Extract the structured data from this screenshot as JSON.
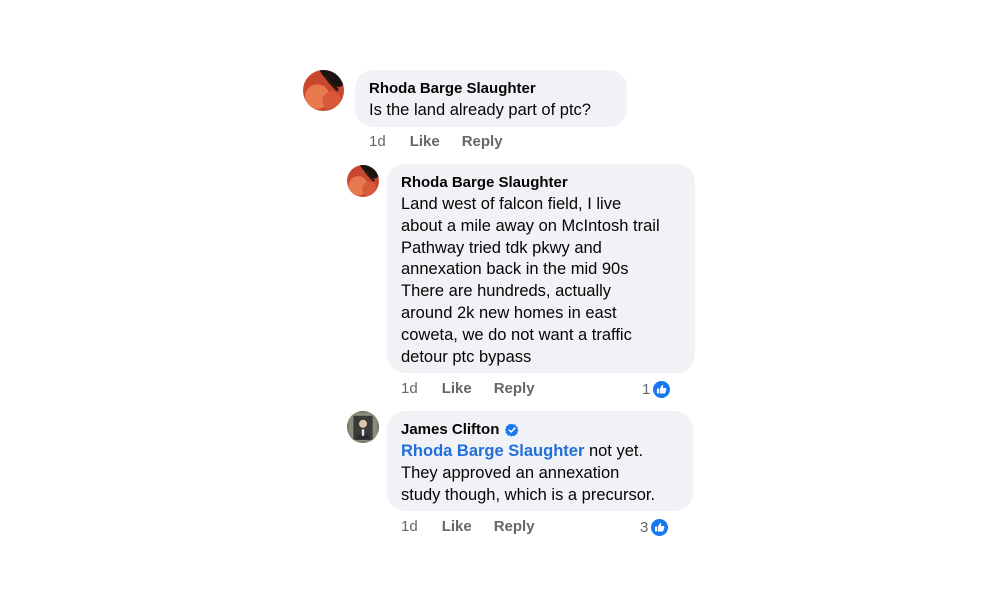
{
  "colors": {
    "bubble_bg": "#f0f2f5",
    "meta_text": "#65676b",
    "mention": "#216fdb",
    "like_blue": "#1877f2"
  },
  "comments": [
    {
      "author": "Rhoda Barge Slaughter",
      "text": "Is the land already part of ptc?",
      "time": "1d",
      "like_label": "Like",
      "reply_label": "Reply",
      "avatar": "profile-photo-rhoda"
    },
    {
      "author": "Rhoda Barge Slaughter",
      "lines": [
        "Land west of falcon field, I live",
        "about a mile away on McIntosh trail",
        "Pathway tried tdk pkwy and",
        "annexation back in the mid 90s",
        "There are hundreds, actually",
        "around 2k new homes in east",
        "coweta, we do not want a traffic",
        "detour ptc bypass"
      ],
      "time": "1d",
      "like_label": "Like",
      "reply_label": "Reply",
      "reaction_count": "1",
      "reaction_icon": "thumbs-up-icon",
      "avatar": "profile-photo-rhoda"
    },
    {
      "author": "James Clifton",
      "verified": true,
      "verified_icon": "verified-badge-icon",
      "mention": "Rhoda Barge Slaughter",
      "first_line_rest": " not yet.",
      "lines": [
        "They approved an annexation",
        "study though, which is a precursor."
      ],
      "time": "1d",
      "like_label": "Like",
      "reply_label": "Reply",
      "reaction_count": "3",
      "reaction_icon": "thumbs-up-icon",
      "avatar": "profile-photo-james"
    }
  ]
}
